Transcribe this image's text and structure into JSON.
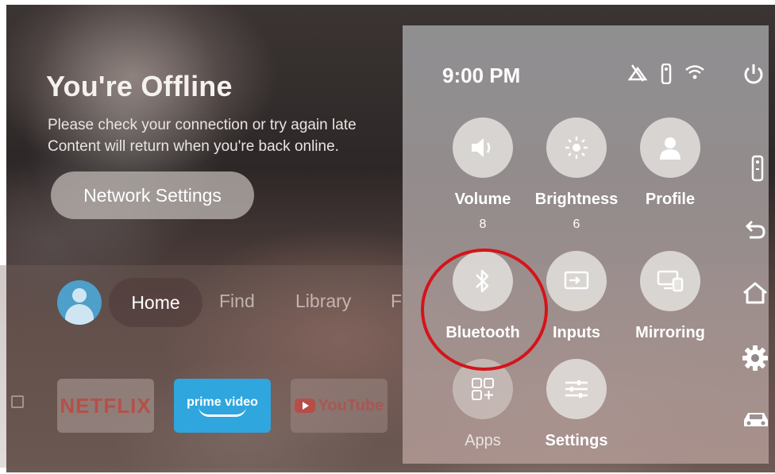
{
  "offline": {
    "title": "You're Offline",
    "line1": "Please check your connection or try again late",
    "line2": "Content will return when you're back online.",
    "button": "Network Settings"
  },
  "nav": {
    "items": [
      "Home",
      "Find",
      "Library",
      "F"
    ],
    "selected": "Home"
  },
  "apps": {
    "netflix": "NETFLIX",
    "prime_line1": "prime video",
    "youtube": "YouTube"
  },
  "quick_settings": {
    "time": "9:00 PM",
    "status_icons": [
      "no-signal-icon",
      "remote-icon",
      "wifi-icon"
    ],
    "tiles": [
      {
        "label": "Volume",
        "value": "8",
        "icon": "speaker-icon"
      },
      {
        "label": "Brightness",
        "value": "6",
        "icon": "sun-icon"
      },
      {
        "label": "Profile",
        "value": "",
        "icon": "person-icon"
      },
      {
        "label": "Bluetooth",
        "value": "",
        "icon": "bluetooth-icon"
      },
      {
        "label": "Inputs",
        "value": "",
        "icon": "input-icon"
      },
      {
        "label": "Mirroring",
        "value": "",
        "icon": "mirroring-icon"
      },
      {
        "label": "Apps",
        "value": "",
        "icon": "apps-icon"
      },
      {
        "label": "Settings",
        "value": "",
        "icon": "sliders-icon"
      }
    ],
    "highlighted_tile": "Bluetooth",
    "highlight_color": "#d4141a"
  },
  "side_buttons": [
    "power-icon",
    "remote-icon",
    "back-icon",
    "home-icon",
    "gear-icon",
    "car-icon"
  ]
}
